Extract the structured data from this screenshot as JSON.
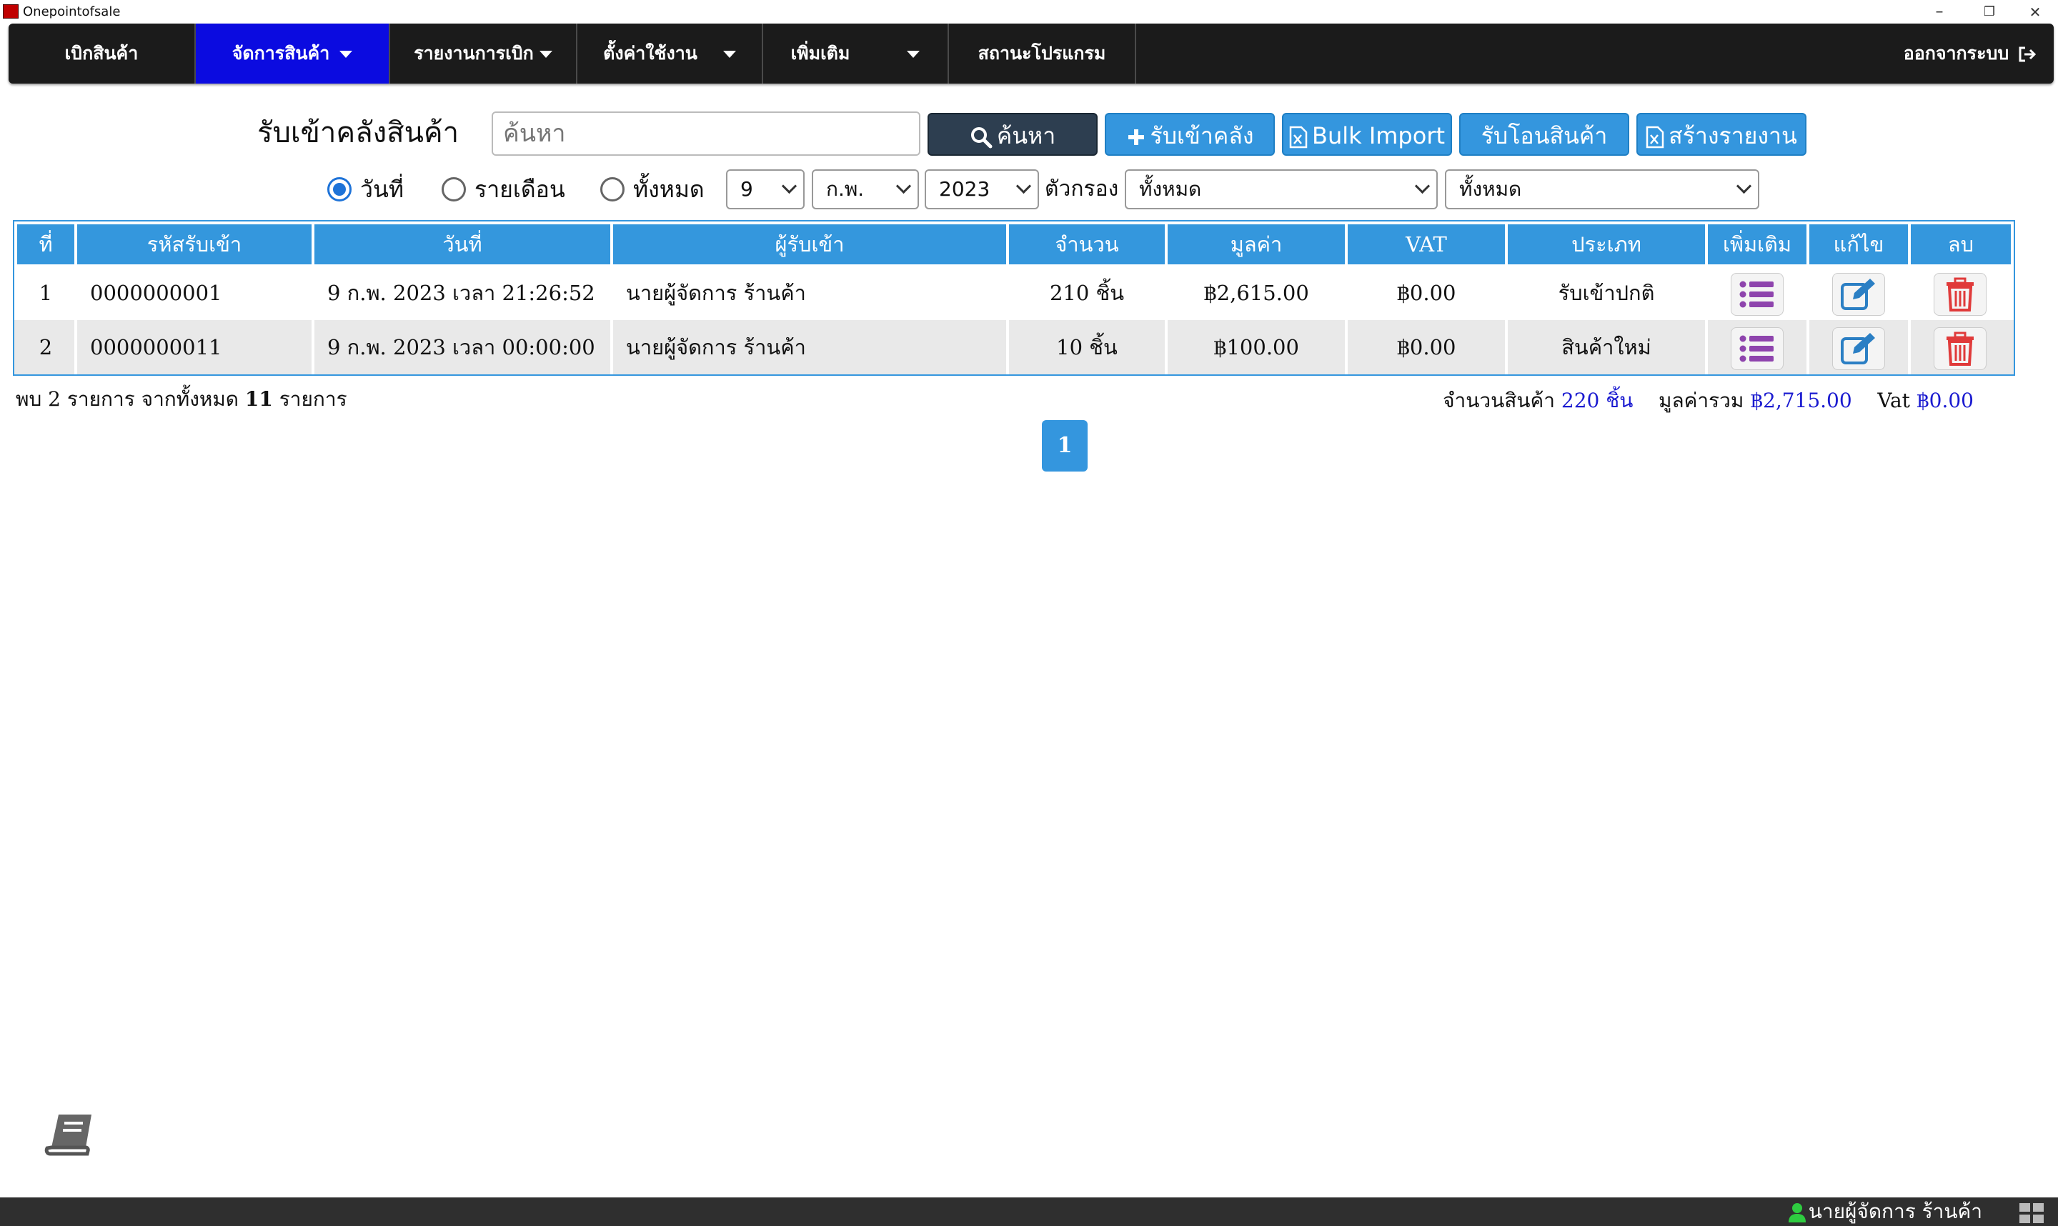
{
  "window": {
    "title": "Onepointofsale",
    "minimize": "–",
    "restore": "❐",
    "close": "✕"
  },
  "nav": {
    "items": [
      {
        "label": "เบิกสินค้า"
      },
      {
        "label": "จัดการสินค้า"
      },
      {
        "label": "รายงานการเบิก"
      },
      {
        "label": "ตั้งค่าใช้งาน"
      },
      {
        "label": "เพิ่มเติม"
      },
      {
        "label": "สถานะโปรแกรม"
      }
    ],
    "logout": "ออกจากระบบ"
  },
  "header": {
    "title": "รับเข้าคลังสินค้า",
    "search_placeholder": "ค้นหา",
    "search_button": "ค้นหา",
    "receive_button": "รับเข้าคลัง",
    "bulk_import_button": "Bulk Import",
    "transfer_button": "รับโอนสินค้า",
    "report_button": "สร้างรายงาน"
  },
  "filters": {
    "radio_day": "วันที่",
    "radio_month": "รายเดือน",
    "radio_all": "ทั้งหมด",
    "selected_radio": "day",
    "day": "9",
    "month": "ก.พ.",
    "year": "2023",
    "filter_label": "ตัวกรอง",
    "filter1": "ทั้งหมด",
    "filter2": "ทั้งหมด"
  },
  "table": {
    "columns": [
      "ที่",
      "รหัสรับเข้า",
      "วันที่",
      "ผู้รับเข้า",
      "จำนวน",
      "มูลค่า",
      "VAT",
      "ประเภท",
      "เพิ่มเติม",
      "แก้ไข",
      "ลบ"
    ],
    "rows": [
      {
        "no": "1",
        "code": "0000000001",
        "date": "9 ก.พ. 2023 เวลา 21:26:52",
        "receiver": "นายผู้จัดการ ร้านค้า",
        "qty": "210 ชิ้น",
        "value": "฿2,615.00",
        "vat": "฿0.00",
        "type": "รับเข้าปกติ"
      },
      {
        "no": "2",
        "code": "0000000011",
        "date": "9 ก.พ. 2023 เวลา 00:00:00",
        "receiver": "นายผู้จัดการ ร้านค้า",
        "qty": "10 ชิ้น",
        "value": "฿100.00",
        "vat": "฿0.00",
        "type": "สินค้าใหม่"
      }
    ]
  },
  "footer": {
    "found_prefix": "พบ",
    "found_count": "2",
    "found_mid": "รายการ จากทั้งหมด",
    "total_count": "11",
    "found_suffix": "รายการ",
    "qty_label": "จำนวนสินค้า",
    "qty_value": "220 ชิ้น",
    "total_label": "มูลค่ารวม",
    "total_value": "฿2,715.00",
    "vat_label": "Vat",
    "vat_value": "฿0.00",
    "page": "1"
  },
  "status": {
    "user": "นายผู้จัดการ ร้านค้า"
  },
  "icons": {
    "search": "search-icon",
    "plus": "plus-icon",
    "excel": "excel-file-icon",
    "details": "list-icon",
    "edit": "edit-icon",
    "delete": "trash-icon",
    "manual": "book-icon",
    "logout": "logout-icon",
    "user": "user-icon",
    "grid": "grid-icon"
  },
  "colors": {
    "accent": "#3496de",
    "nav_active": "#0b0be0",
    "nav_bg": "#1b1b1b",
    "delete": "#e03a3a",
    "details": "#8e44ad",
    "edit": "#2b7fc4"
  }
}
